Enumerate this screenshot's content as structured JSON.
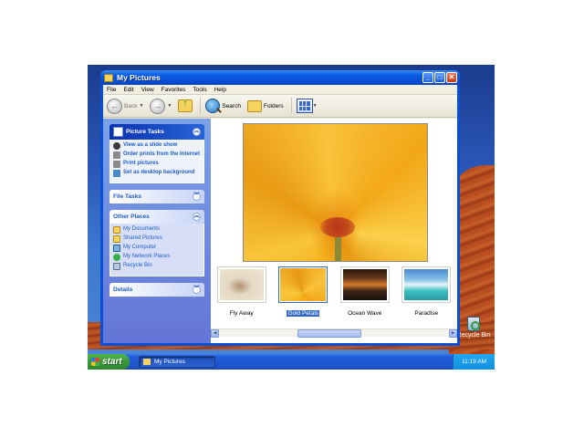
{
  "window": {
    "title": "My Pictures"
  },
  "menu": [
    "File",
    "Edit",
    "View",
    "Favorites",
    "Tools",
    "Help"
  ],
  "toolbar": {
    "back_label": "Back",
    "search_label": "Search",
    "folders_label": "Folders"
  },
  "taskpane": {
    "picture_tasks": {
      "title": "Picture Tasks",
      "items": [
        "View as a slide show",
        "Order prints from the Internet",
        "Print pictures",
        "Set as desktop background"
      ]
    },
    "file_tasks": {
      "title": "File Tasks"
    },
    "other_places": {
      "title": "Other Places",
      "items": [
        "My Documents",
        "Shared Pictures",
        "My Computer",
        "My Network Places",
        "Recycle Bin"
      ]
    },
    "details": {
      "title": "Details"
    }
  },
  "thumbnails": [
    {
      "label": "Fly Away",
      "selected": false
    },
    {
      "label": "Gold Petals",
      "selected": true
    },
    {
      "label": "Ocean Wave",
      "selected": false
    },
    {
      "label": "Paradise",
      "selected": false
    }
  ],
  "taskbar": {
    "start_label": "start",
    "task_item_label": "My Pictures",
    "clock": "11:19 AM"
  },
  "desktop": {
    "recycle_bin_label": "Recycle Bin"
  }
}
